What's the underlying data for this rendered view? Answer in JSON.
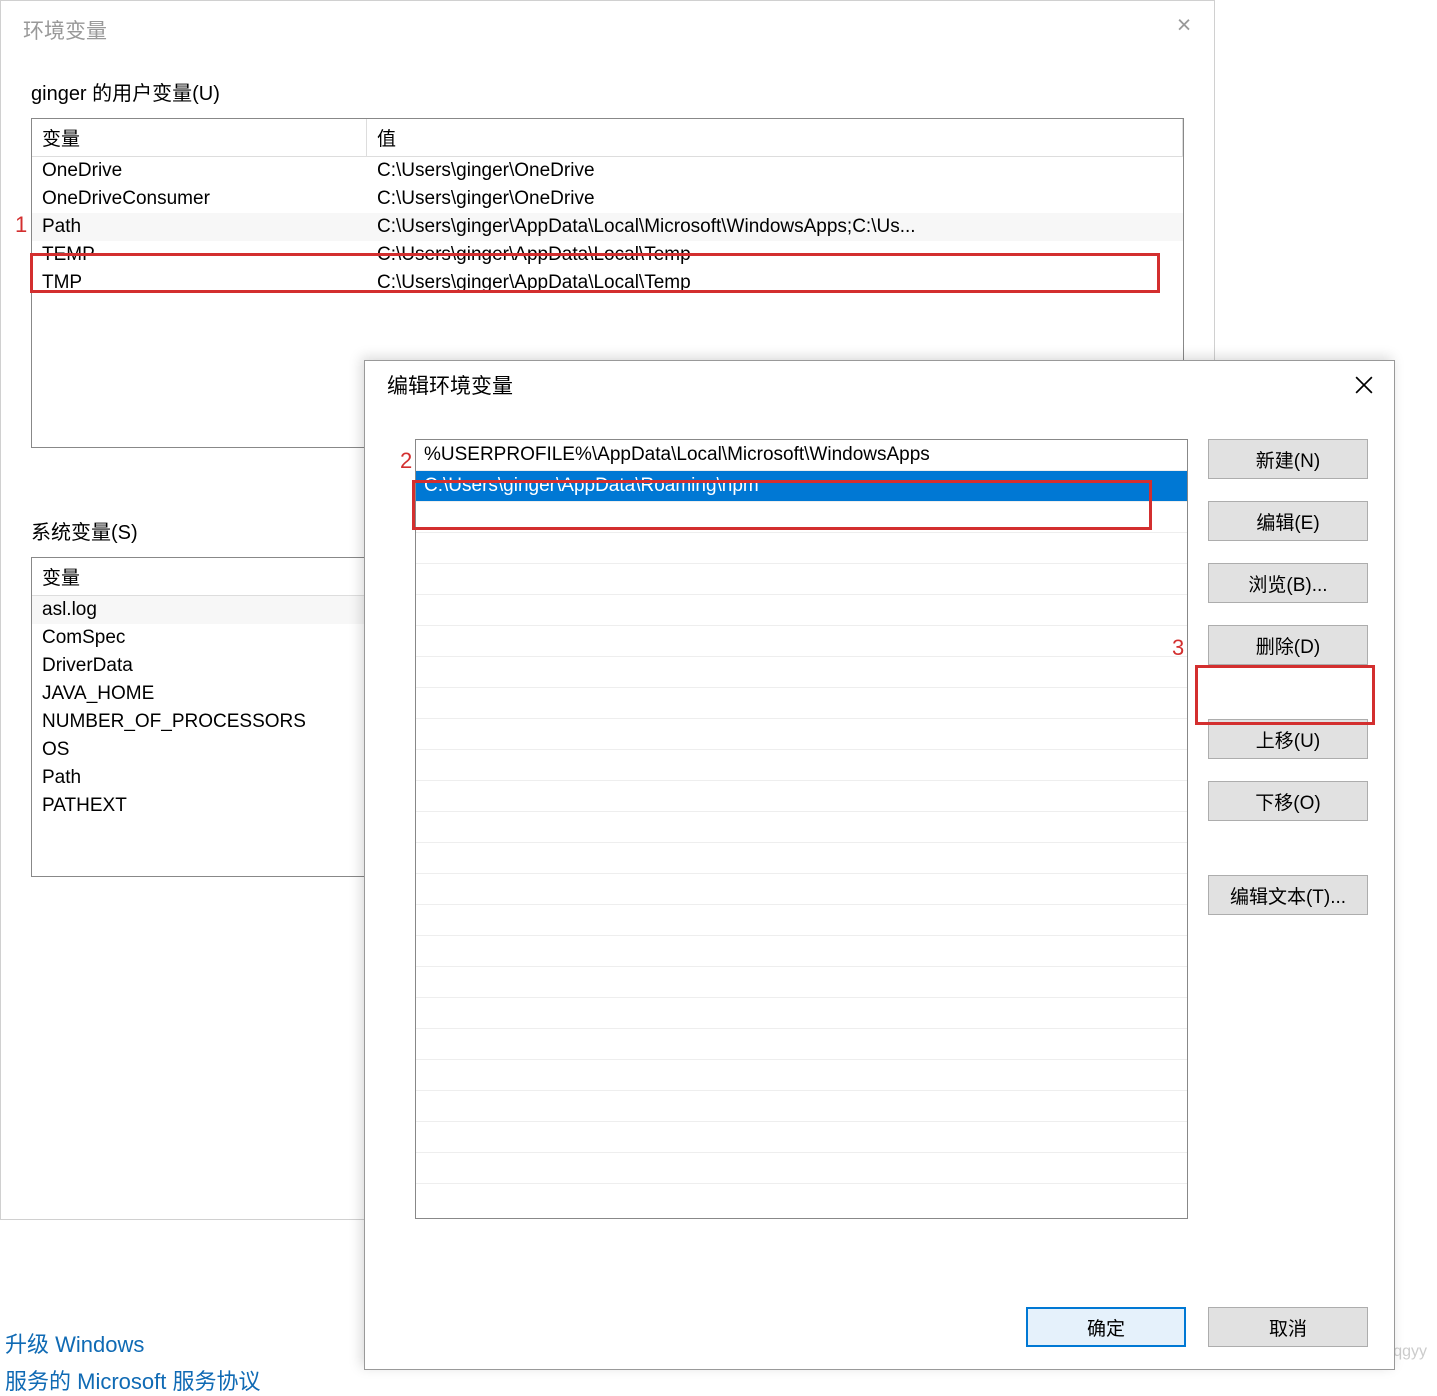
{
  "bg_window": {
    "title": "环境变量",
    "user_section_label": "ginger 的用户变量(U)",
    "system_section_label": "系统变量(S)",
    "headers": {
      "name": "变量",
      "value": "值"
    },
    "user_vars": [
      {
        "name": "OneDrive",
        "value": "C:\\Users\\ginger\\OneDrive"
      },
      {
        "name": "OneDriveConsumer",
        "value": "C:\\Users\\ginger\\OneDrive"
      },
      {
        "name": "Path",
        "value": "C:\\Users\\ginger\\AppData\\Local\\Microsoft\\WindowsApps;C:\\Us..."
      },
      {
        "name": "TEMP",
        "value": "C:\\Users\\ginger\\AppData\\Local\\Temp"
      },
      {
        "name": "TMP",
        "value": "C:\\Users\\ginger\\AppData\\Local\\Temp"
      }
    ],
    "system_vars": [
      {
        "name": "asl.log"
      },
      {
        "name": "ComSpec"
      },
      {
        "name": "DriverData"
      },
      {
        "name": "JAVA_HOME"
      },
      {
        "name": "NUMBER_OF_PROCESSORS"
      },
      {
        "name": "OS"
      },
      {
        "name": "Path"
      },
      {
        "name": "PATHEXT"
      }
    ]
  },
  "fg_window": {
    "title": "编辑环境变量",
    "list": [
      {
        "value": "%USERPROFILE%\\AppData\\Local\\Microsoft\\WindowsApps",
        "selected": false
      },
      {
        "value": "C:\\Users\\ginger\\AppData\\Roaming\\npm",
        "selected": true
      }
    ],
    "buttons": {
      "new": "新建(N)",
      "edit": "编辑(E)",
      "browse": "浏览(B)...",
      "delete": "删除(D)",
      "move_up": "上移(U)",
      "move_down": "下移(O)",
      "edit_text": "编辑文本(T)...",
      "ok": "确定",
      "cancel": "取消"
    }
  },
  "annotations": {
    "a1": "1",
    "a2": "2",
    "a3": "3"
  },
  "bottom": {
    "link1": "升级 Windows",
    "link2": "服务的 Microsoft 服务协议"
  },
  "watermark": "CSDN @gingerqgyy"
}
